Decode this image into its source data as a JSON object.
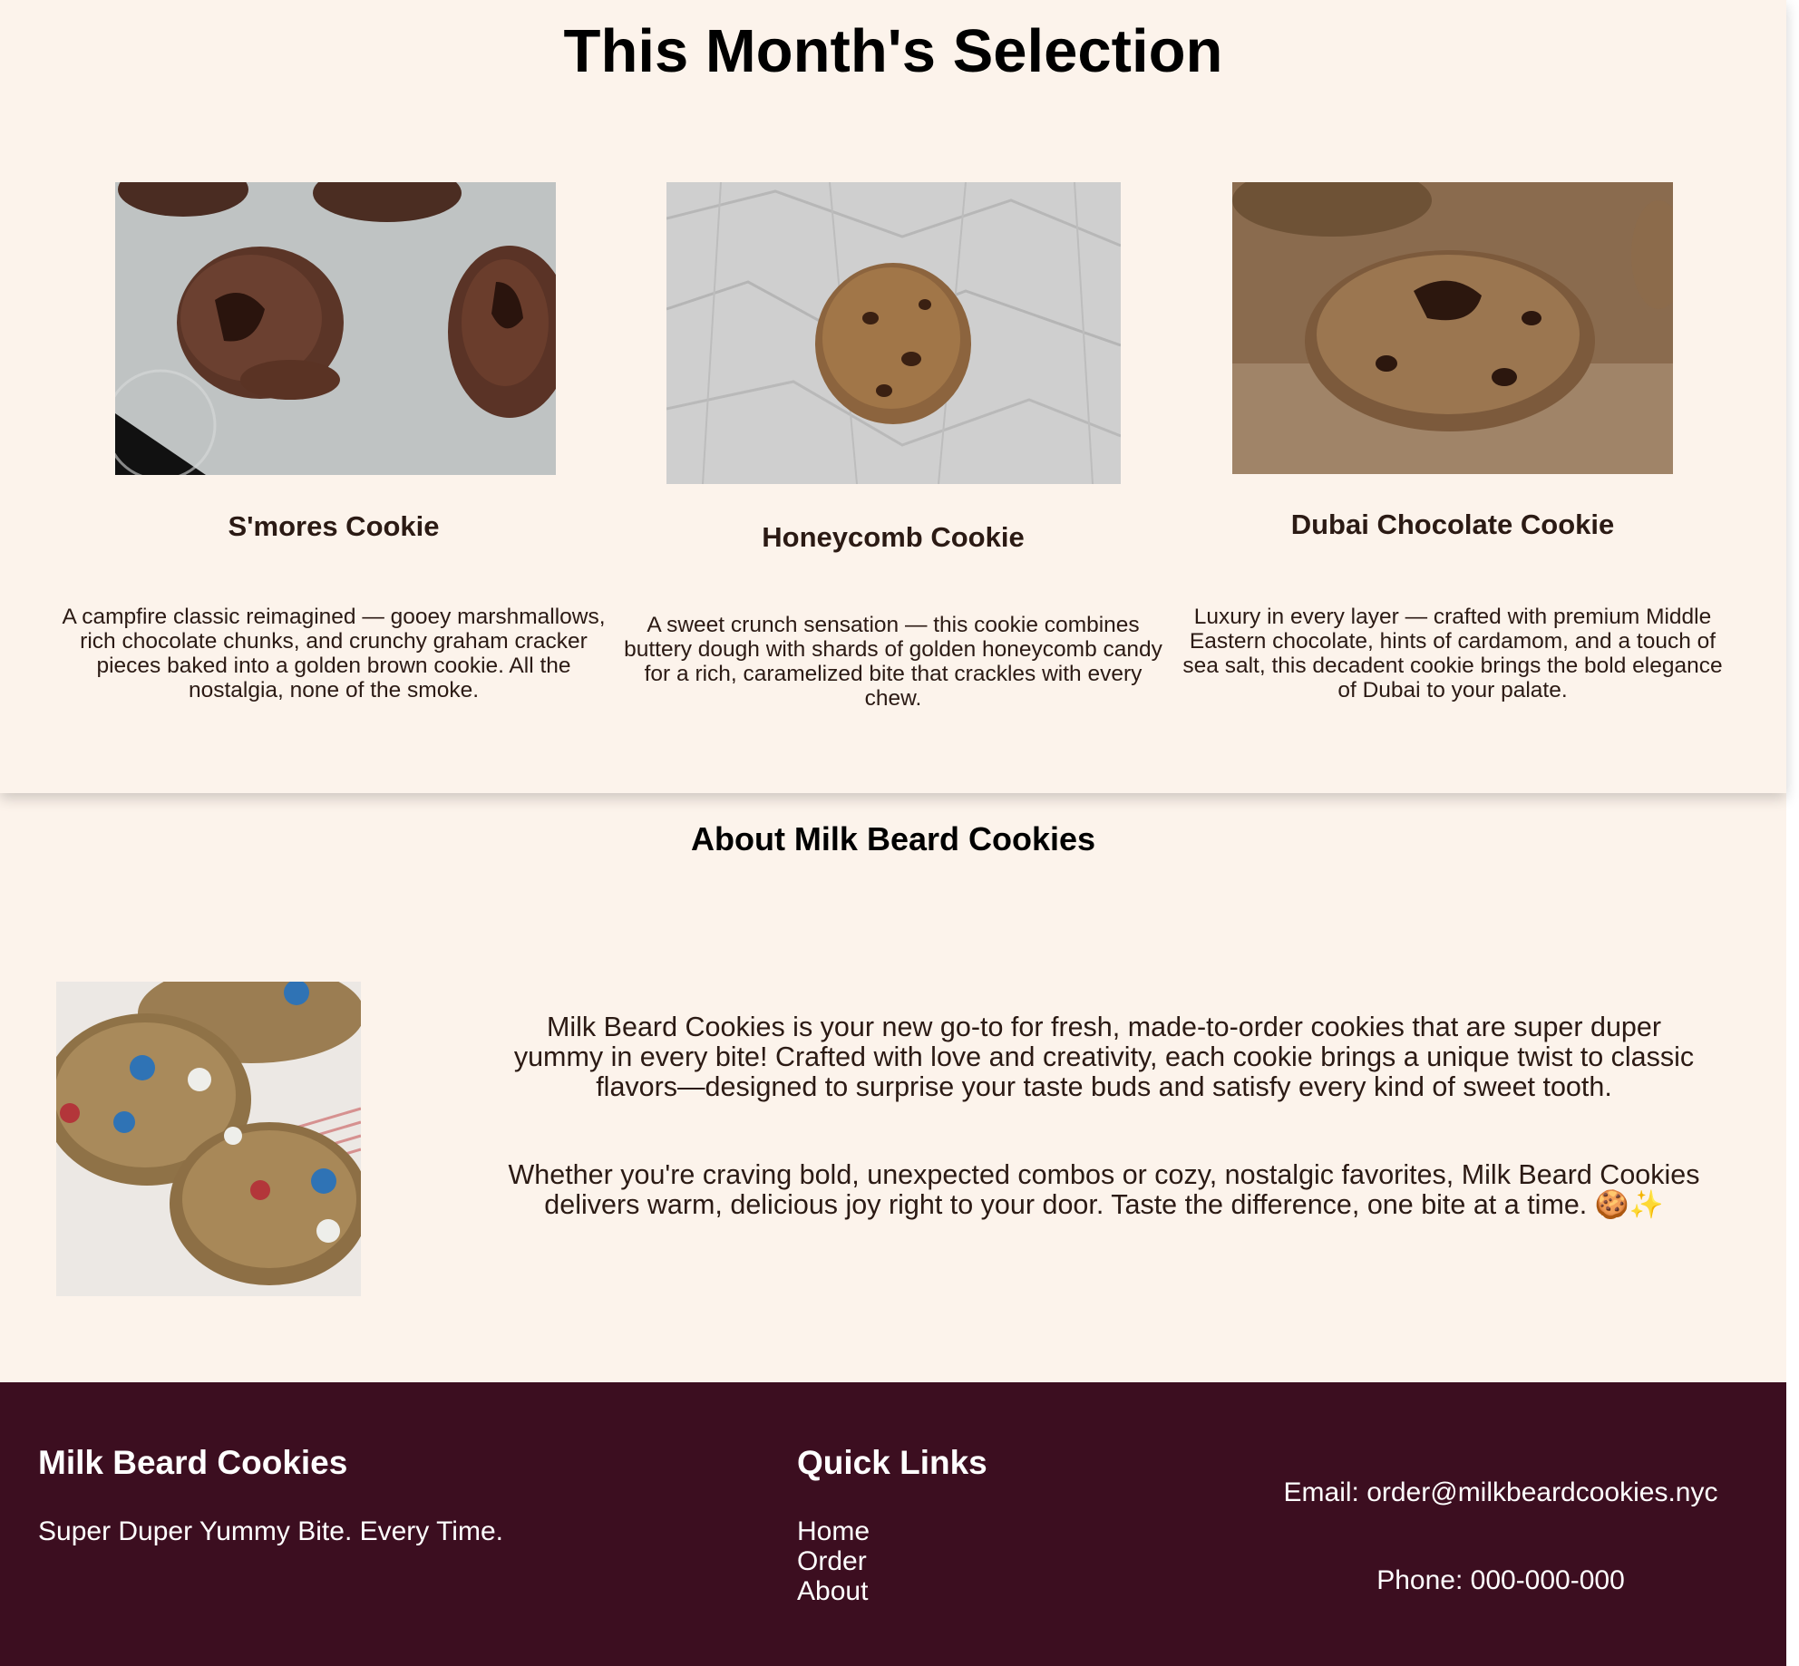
{
  "selection": {
    "title": "This Month's Selection",
    "cookies": [
      {
        "name": "S'mores Cookie",
        "description": "A campfire classic reimagined — gooey marshmallows, rich chocolate chunks, and crunchy graham cracker pieces baked into a golden brown cookie. All the nostalgia, none of the smoke."
      },
      {
        "name": "Honeycomb Cookie",
        "description": "A sweet crunch sensation — this cookie combines buttery dough with shards of golden honeycomb candy for a rich, caramelized bite that crackles with every chew."
      },
      {
        "name": "Dubai Chocolate Cookie",
        "description": "Luxury in every layer — crafted with premium Middle Eastern chocolate, hints of cardamom, and a touch of sea salt, this decadent cookie brings the bold elegance of Dubai to your palate."
      }
    ]
  },
  "about": {
    "title": "About Milk Beard Cookies",
    "paragraphs": [
      "Milk Beard Cookies is your new go-to for fresh, made-to-order cookies that are super duper yummy in every bite! Crafted with love and creativity, each cookie brings a unique twist to classic flavors—designed to surprise your taste buds and satisfy every kind of sweet tooth.",
      "Whether you're craving bold, unexpected combos or cozy, nostalgic favorites, Milk Beard Cookies delivers warm, delicious joy right to your door. Taste the difference, one bite at a time. 🍪✨"
    ]
  },
  "footer": {
    "brand": "Milk Beard Cookies",
    "tagline": "Super Duper Yummy Bite. Every Time.",
    "quick_links_title": "Quick Links",
    "links": [
      "Home",
      "Order",
      "About"
    ],
    "email": "Email: order@milkbeardcookies.nyc",
    "phone": "Phone: 000-000-000"
  },
  "colors": {
    "background": "#fcf3eb",
    "footer_background": "#3c0e20",
    "text": "#2b1a14"
  }
}
